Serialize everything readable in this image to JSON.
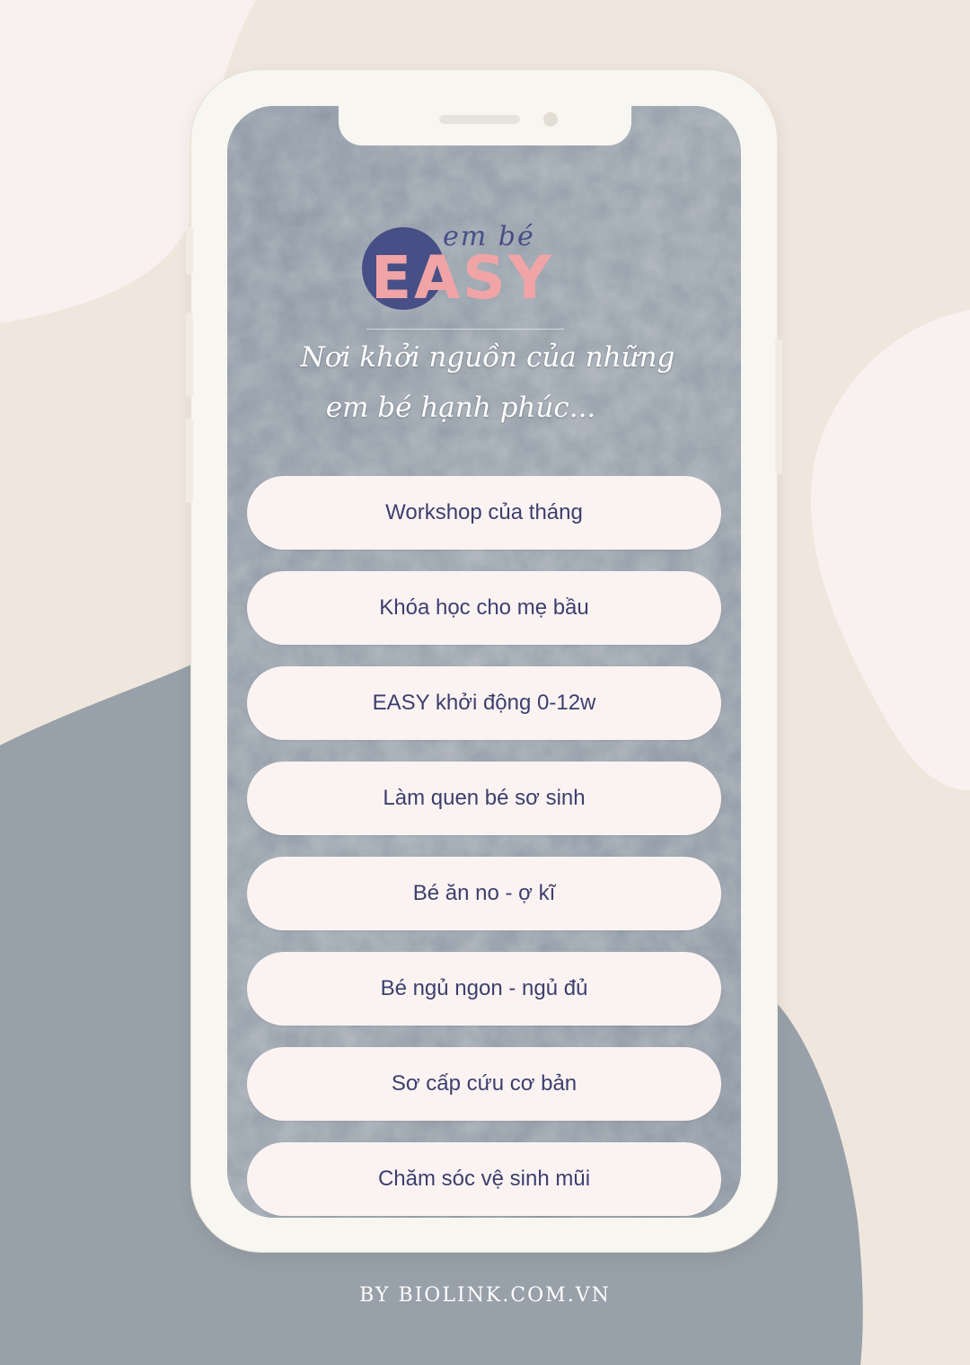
{
  "colors": {
    "page_background": "#efe6dd",
    "blob_gray": "#98a0a9",
    "blob_light": "#f8f1ef",
    "phone_frame": "#f8f6f0",
    "button_background": "#fbf3f2",
    "button_text": "#3c3f6e",
    "logo_pink": "#f0a4a6",
    "logo_navy": "#474f86"
  },
  "profile": {
    "logo_subtitle": "em bé",
    "logo_title": "EASY",
    "tagline_line1": "Nơi khởi nguồn của những",
    "tagline_line2": "em bé hạnh phúc..."
  },
  "links": [
    {
      "label": "Workshop của tháng"
    },
    {
      "label": "Khóa học cho mẹ bầu"
    },
    {
      "label": "EASY khởi động 0-12w"
    },
    {
      "label": "Làm quen bé sơ sinh"
    },
    {
      "label": "Bé ăn no - ợ kĩ"
    },
    {
      "label": "Bé ngủ ngon - ngủ đủ"
    },
    {
      "label": "Sơ cấp cứu cơ bản"
    },
    {
      "label": "Chăm sóc vệ sinh mũi"
    }
  ],
  "footer": {
    "text": "BY BIOLINK.COM.VN"
  }
}
